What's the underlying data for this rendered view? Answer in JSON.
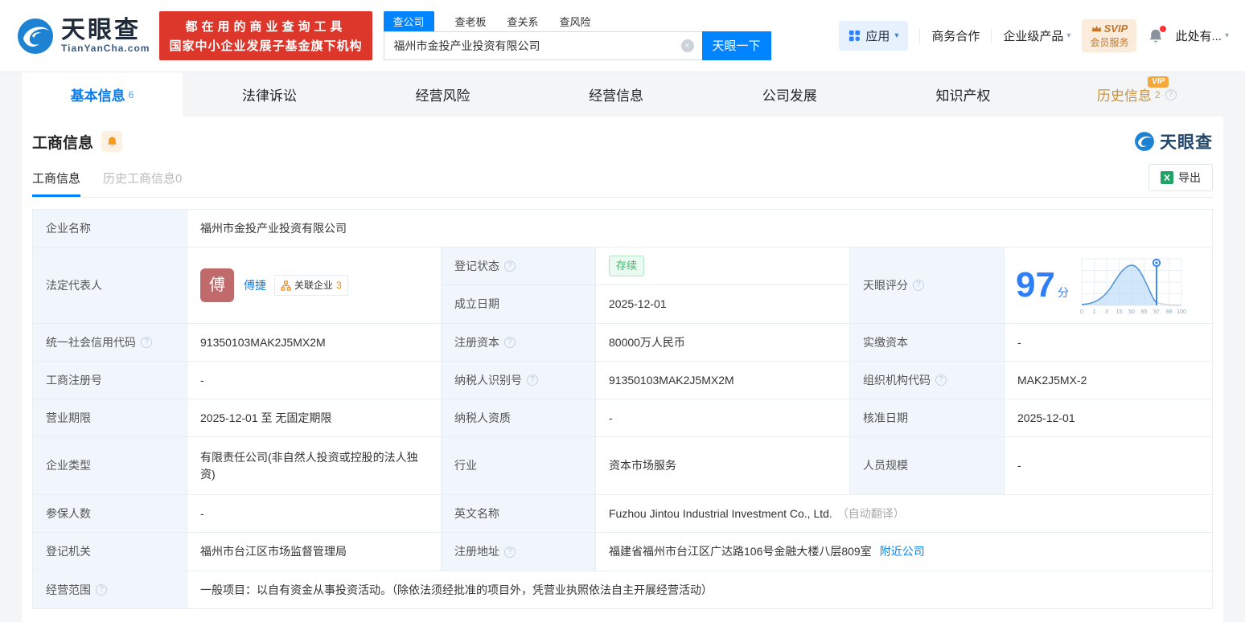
{
  "icons": {
    "help": "?",
    "caret": "▾",
    "clear": "×"
  },
  "colors": {
    "accent_blue": "#0084ff",
    "score_blue": "#2e7ef7",
    "brand_red": "#dd372c",
    "vip_orange": "#c9913e",
    "badge_green": "#3eb96f",
    "avatar_red": "#c06a6b"
  },
  "header": {
    "logo": {
      "name": "天眼查",
      "domain": "TianYanCha.com"
    },
    "slogan": {
      "line1": "都在用的商业查询工具",
      "line2": "国家中小企业发展子基金旗下机构"
    },
    "search": {
      "tabs": [
        {
          "label": "查公司"
        },
        {
          "label": "查老板"
        },
        {
          "label": "查关系"
        },
        {
          "label": "查风险"
        }
      ],
      "query": "福州市金投产业投资有限公司",
      "button": "天眼一下"
    },
    "nav": {
      "apps": "应用",
      "cooperation": "商务合作",
      "enterprise": "企业级产品",
      "svip_top": "SVIP",
      "svip_bottom": "会员服务",
      "account": "此处有..."
    }
  },
  "tabbar": {
    "tabs": [
      {
        "label": "基本信息",
        "count": "6"
      },
      {
        "label": "法律诉讼"
      },
      {
        "label": "经营风险"
      },
      {
        "label": "经营信息"
      },
      {
        "label": "公司发展"
      },
      {
        "label": "知识产权"
      },
      {
        "label": "历史信息",
        "count": "2",
        "vip": "VIP"
      }
    ]
  },
  "section": {
    "title": "工商信息",
    "watermark": "天眼查",
    "subtabs": [
      {
        "label": "工商信息"
      },
      {
        "label": "历史工商信息0"
      }
    ],
    "export_label": "导出"
  },
  "score": {
    "value": "97",
    "unit": "分",
    "ticks": [
      "0",
      "1",
      "3",
      "15",
      "50",
      "85",
      "97",
      "99",
      "100"
    ]
  },
  "table": {
    "company_name": {
      "label": "企业名称",
      "value": "福州市金投产业投资有限公司"
    },
    "legal_rep": {
      "label": "法定代表人",
      "avatar": "傅",
      "name": "傅捷",
      "related_label": "关联企业",
      "related_count": "3"
    },
    "reg_status": {
      "label": "登记状态",
      "value": "存续"
    },
    "establish_date": {
      "label": "成立日期",
      "value": "2025-12-01"
    },
    "tyc_score": {
      "label": "天眼评分"
    },
    "credit_code": {
      "label": "统一社会信用代码",
      "value": "91350103MAK2J5MX2M"
    },
    "reg_capital": {
      "label": "注册资本",
      "value": "80000万人民币"
    },
    "paid_capital": {
      "label": "实缴资本",
      "value": "-"
    },
    "reg_number": {
      "label": "工商注册号",
      "value": "-"
    },
    "taxpayer_id": {
      "label": "纳税人识别号",
      "value": "91350103MAK2J5MX2M"
    },
    "org_code": {
      "label": "组织机构代码",
      "value": "MAK2J5MX-2"
    },
    "business_term": {
      "label": "营业期限",
      "value": "2025-12-01 至 无固定期限"
    },
    "taxpayer_quality": {
      "label": "纳税人资质",
      "value": "-"
    },
    "approval_date": {
      "label": "核准日期",
      "value": "2025-12-01"
    },
    "company_type": {
      "label": "企业类型",
      "value": "有限责任公司(非自然人投资或控股的法人独资)"
    },
    "industry": {
      "label": "行业",
      "value": "资本市场服务"
    },
    "staff_size": {
      "label": "人员规模",
      "value": "-"
    },
    "insured_count": {
      "label": "参保人数",
      "value": "-"
    },
    "english_name": {
      "label": "英文名称",
      "value": "Fuzhou Jintou Industrial Investment Co., Ltd.",
      "note": "（自动翻译）"
    },
    "reg_authority": {
      "label": "登记机关",
      "value": "福州市台江区市场监督管理局"
    },
    "reg_address": {
      "label": "注册地址",
      "value": "福建省福州市台江区广达路106号金融大楼八层809室",
      "link": "附近公司"
    },
    "business_scope": {
      "label": "经营范围",
      "value": "一般项目：以自有资金从事投资活动。（除依法须经批准的项目外，凭营业执照依法自主开展经营活动）"
    }
  }
}
